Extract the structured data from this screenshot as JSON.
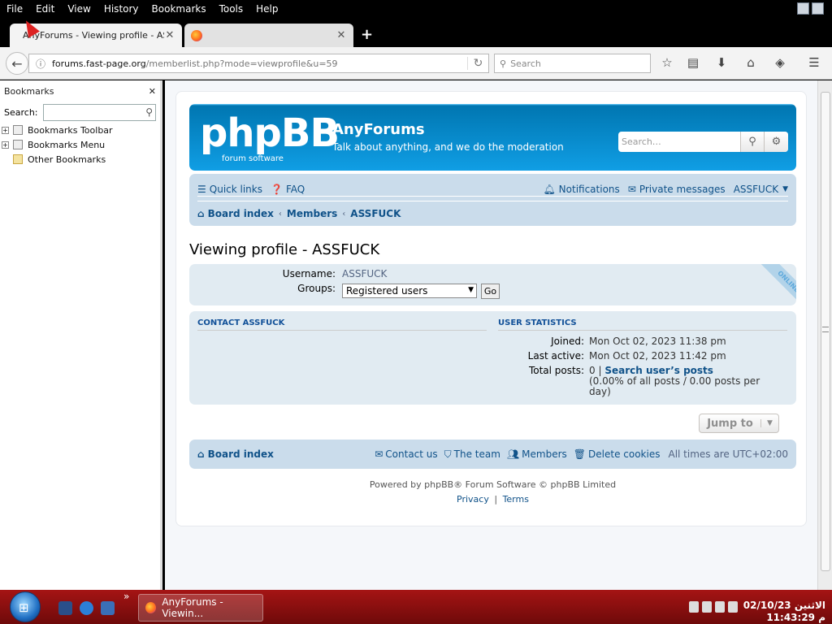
{
  "menubar": {
    "items": [
      "File",
      "Edit",
      "View",
      "History",
      "Bookmarks",
      "Tools",
      "Help"
    ]
  },
  "tabs": [
    {
      "title": "AnyForums - Viewing profile - ASS...",
      "active": true
    },
    {
      "title": "",
      "active": false
    }
  ],
  "navbar": {
    "url_host": "forums.fast-page.org",
    "url_path": "/memberlist.php?mode=viewprofile&u=59",
    "search_placeholder": "Search"
  },
  "sidebar": {
    "title": "Bookmarks",
    "search_label": "Search:",
    "items": [
      {
        "label": "Bookmarks Toolbar",
        "expandable": true
      },
      {
        "label": "Bookmarks Menu",
        "expandable": true
      },
      {
        "label": "Other Bookmarks",
        "expandable": false
      }
    ]
  },
  "header": {
    "logo_text": "phpBB",
    "logo_subtext": "forum  software",
    "site_title": "AnyForums",
    "site_description": "Talk about anything, and we do the moderation",
    "search_placeholder": "Search…"
  },
  "navpanel": {
    "quick_links": "Quick links",
    "faq": "FAQ",
    "notifications": "Notifications",
    "private_messages": "Private messages",
    "username": "ASSFUCK",
    "breadcrumbs": [
      "Board index",
      "Members",
      "ASSFUCK"
    ]
  },
  "profile": {
    "page_title": "Viewing profile - ASSFUCK",
    "username_label": "Username:",
    "username": "ASSFUCK",
    "groups_label": "Groups:",
    "groups_selected": "Registered users",
    "go_label": "Go",
    "online_badge": "ONLINE",
    "contact_heading": "CONTACT ASSFUCK",
    "stats_heading": "USER STATISTICS",
    "stats": {
      "joined_label": "Joined:",
      "joined": "Mon Oct 02, 2023 11:38 pm",
      "last_active_label": "Last active:",
      "last_active": "Mon Oct 02, 2023 11:42 pm",
      "total_posts_label": "Total posts:",
      "total_posts": "0 |",
      "search_posts_link": "Search user’s posts",
      "posts_detail": "(0.00% of all posts / 0.00 posts per day)"
    }
  },
  "jump_to": "Jump to",
  "footer_nav": {
    "board_index": "Board index",
    "contact_us": "Contact us",
    "the_team": "The team",
    "members": "Members",
    "delete_cookies": "Delete cookies",
    "timezone": "All times are UTC+02:00"
  },
  "copyright": {
    "line1": "Powered by phpBB® Forum Software © phpBB Limited",
    "privacy": "Privacy",
    "separator": "|",
    "terms": "Terms"
  },
  "taskbar": {
    "task_label": "AnyForums - Viewin...",
    "clock_line1": "02/10/23 الاثنين",
    "clock_line2": "11:43:29 م"
  },
  "colors": {
    "header_blue": "#12a3eb",
    "link_blue": "#105289",
    "taskbar_red": "#a51414"
  }
}
